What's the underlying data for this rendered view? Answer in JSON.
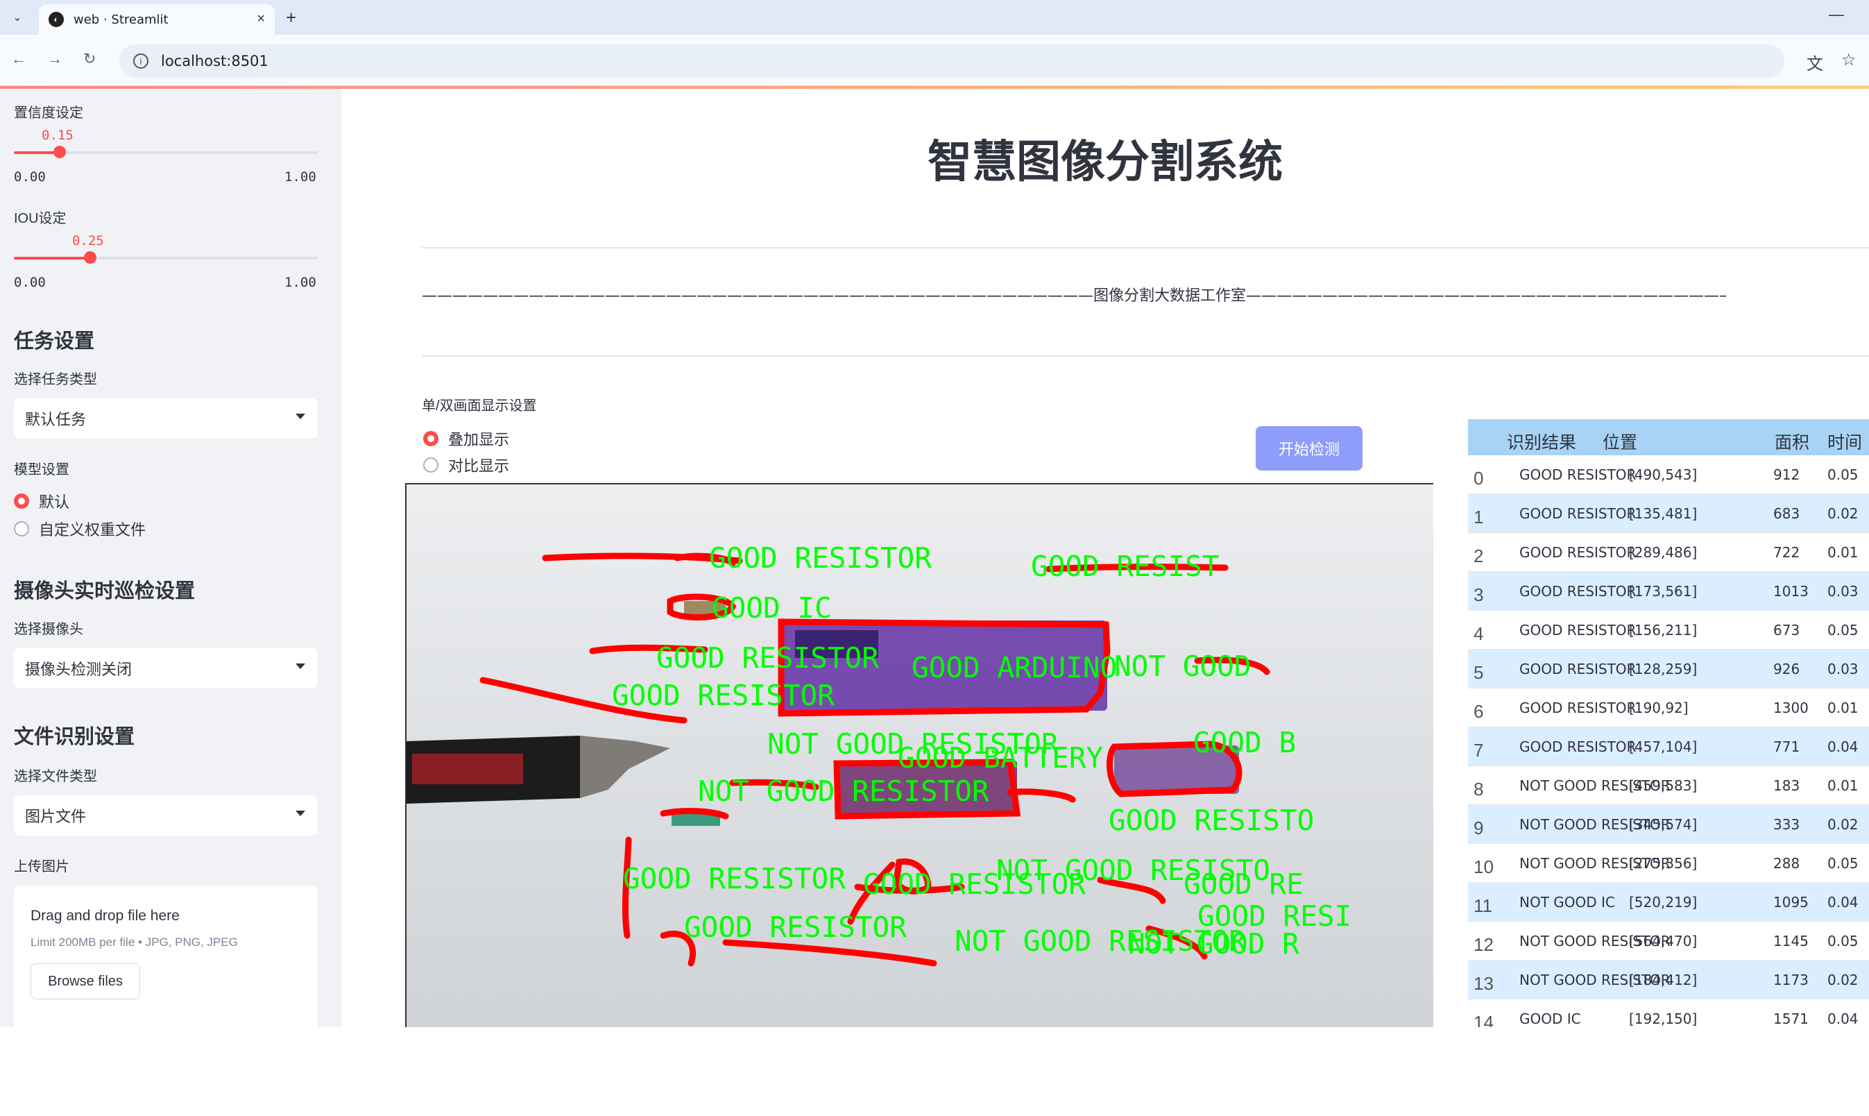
{
  "browser": {
    "tab_title": "web · Streamlit",
    "url": "localhost:8501",
    "new_tab": "+",
    "close": "×"
  },
  "sidebar": {
    "confidence": {
      "label": "置信度设定",
      "value": "0.15",
      "value_fraction": 0.15,
      "min": "0.00",
      "max": "1.00"
    },
    "iou": {
      "label": "IOU设定",
      "value": "0.25",
      "value_fraction": 0.25,
      "min": "0.00",
      "max": "1.00"
    },
    "task_header": "任务设置",
    "task_type_label": "选择任务类型",
    "task_type_value": "默认任务",
    "model_label": "模型设置",
    "model_options": [
      "默认",
      "自定义权重文件"
    ],
    "model_selected": "默认",
    "camera_header": "摄像头实时巡检设置",
    "camera_label": "选择摄像头",
    "camera_value": "摄像头检测关闭",
    "file_header": "文件识别设置",
    "file_type_label": "选择文件类型",
    "file_type_value": "图片文件",
    "upload_label": "上传图片",
    "upload_title": "Drag and drop file here",
    "upload_limit": "Limit 200MB per file • JPG, PNG, JPEG",
    "browse_label": "Browse files"
  },
  "main": {
    "title": "智慧图像分割系统",
    "studio_banner": "————————————————————————————————————————————图像分割大数据工作室————————————————————————————————————————————",
    "display_label": "单/双画面显示设置",
    "display_options": [
      "叠加显示",
      "对比显示"
    ],
    "display_selected": "叠加显示",
    "start_button": "开始检测"
  },
  "detections_overlay": [
    "GOOD RESISTOR",
    "GOOD RESIST",
    "GOOD IC",
    "GOOD RESISTOR",
    "GOOD ARDUINO",
    "NOT GOOD",
    "GOOD RESISTOR",
    "NOT GOOD RESISTOR",
    "GOOD B",
    "GOOD BATTERY",
    "NOT GOOD RESISTOR",
    "GOOD RESISTO",
    "GOOD RESISTOR",
    "NOT GOOD RESISTO",
    "GOOD RESISTOR",
    "GOOD RE",
    "GOOD RESI",
    "GOOD RESISTOR",
    "NOT GOOD RESISTOR",
    "NOT GOOD R"
  ],
  "results_table": {
    "columns": [
      "识别结果",
      "位置",
      "面积",
      "时间"
    ],
    "rows": [
      {
        "idx": "0",
        "result": "GOOD RESISTOR",
        "pos": "[490,543]",
        "area": "912",
        "time": "0.05"
      },
      {
        "idx": "1",
        "result": "GOOD RESISTOR",
        "pos": "[135,481]",
        "area": "683",
        "time": "0.02"
      },
      {
        "idx": "2",
        "result": "GOOD RESISTOR",
        "pos": "[289,486]",
        "area": "722",
        "time": "0.01"
      },
      {
        "idx": "3",
        "result": "GOOD RESISTOR",
        "pos": "[173,561]",
        "area": "1013",
        "time": "0.03"
      },
      {
        "idx": "4",
        "result": "GOOD RESISTOR",
        "pos": "[156,211]",
        "area": "673",
        "time": "0.05"
      },
      {
        "idx": "5",
        "result": "GOOD RESISTOR",
        "pos": "[128,259]",
        "area": "926",
        "time": "0.03"
      },
      {
        "idx": "6",
        "result": "GOOD RESISTOR",
        "pos": "[190,92]",
        "area": "1300",
        "time": "0.01"
      },
      {
        "idx": "7",
        "result": "GOOD RESISTOR",
        "pos": "[457,104]",
        "area": "771",
        "time": "0.04"
      },
      {
        "idx": "8",
        "result": "NOT GOOD RESISTOR",
        "pos": "[459,583]",
        "area": "183",
        "time": "0.01"
      },
      {
        "idx": "9",
        "result": "NOT GOOD RESISTOR",
        "pos": "[345,574]",
        "area": "333",
        "time": "0.02"
      },
      {
        "idx": "10",
        "result": "NOT GOOD RESISTOR",
        "pos": "[275,356]",
        "area": "288",
        "time": "0.05"
      },
      {
        "idx": "11",
        "result": "NOT GOOD IC",
        "pos": "[520,219]",
        "area": "1095",
        "time": "0.04"
      },
      {
        "idx": "12",
        "result": "NOT GOOD RESISTOR",
        "pos": "[564,470]",
        "area": "1145",
        "time": "0.05"
      },
      {
        "idx": "13",
        "result": "NOT GOOD RESISTOR",
        "pos": "[184,412]",
        "area": "1173",
        "time": "0.02"
      },
      {
        "idx": "14",
        "result": "GOOD IC",
        "pos": "[192,150]",
        "area": "1571",
        "time": "0.04"
      }
    ]
  },
  "colors": {
    "accent": "#ff4b4b",
    "sidebar_bg": "#f0f2f6",
    "table_header": "#a8d3f5",
    "table_alt": "#dbeeff",
    "button": "#8e9dfa",
    "mask": "#ff0000",
    "label": "#00ff00"
  }
}
